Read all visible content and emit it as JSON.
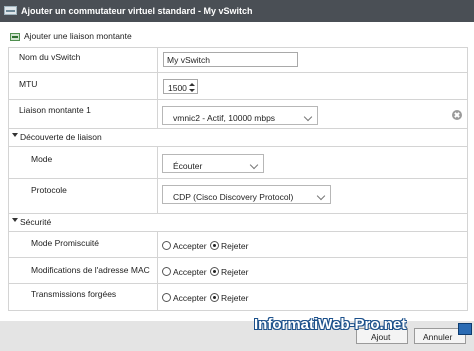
{
  "window": {
    "title": "Ajouter un commutateur virtuel standard - My vSwitch"
  },
  "toolbar": {
    "add_uplink_label": "Ajouter une liaison montante"
  },
  "form": {
    "vswitch_name": {
      "label": "Nom du vSwitch",
      "value": "My vSwitch"
    },
    "mtu": {
      "label": "MTU",
      "value": "1500"
    },
    "uplink1": {
      "label": "Liaison montante 1",
      "value": "vmnic2 - Actif, 10000 mbps"
    },
    "discovery": {
      "section_label": "Découverte de liaison",
      "mode": {
        "label": "Mode",
        "value": "Écouter"
      },
      "protocol": {
        "label": "Protocole",
        "value": "CDP (Cisco Discovery Protocol)"
      }
    },
    "security": {
      "section_label": "Sécurité",
      "accept_label": "Accepter",
      "reject_label": "Rejeter",
      "rows": [
        {
          "label": "Mode Promiscuité",
          "selected": "reject"
        },
        {
          "label": "Modifications de l'adresse MAC",
          "selected": "reject"
        },
        {
          "label": "Transmissions forgées",
          "selected": "reject"
        }
      ]
    }
  },
  "footer": {
    "add_button_label": "Ajout",
    "cancel_button_label": "Annuler"
  },
  "watermark": {
    "text": "InformatiWeb-Pro.net"
  },
  "colors": {
    "titlebar_bg": "#4a4f55",
    "footer_bg": "#e4e4e4",
    "border": "#d4d4d4"
  }
}
